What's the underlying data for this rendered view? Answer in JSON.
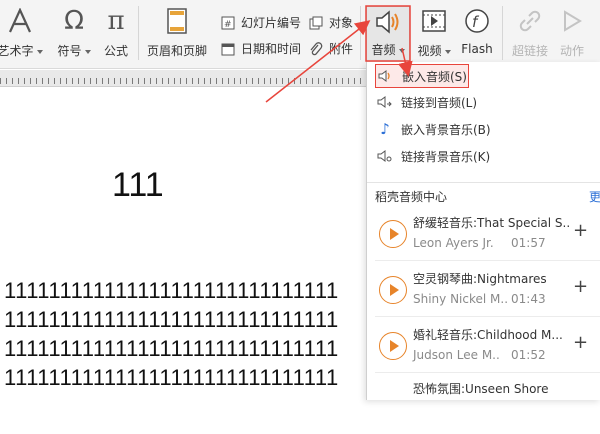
{
  "toolbar": {
    "wordart_label": "艺术字",
    "symbol_label": "符号",
    "formula_label": "公式",
    "header_footer_label": "页眉和页脚",
    "slide_number_label": "幻灯片编号",
    "object_label": "对象",
    "datetime_label": "日期和时间",
    "attachment_label": "附件",
    "audio_label": "音频",
    "video_label": "视频",
    "flash_label": "Flash",
    "hyperlink_label": "超链接",
    "action_label": "动作"
  },
  "slide": {
    "number_text": "111",
    "rows": [
      "111111111111111111111111111111",
      "111111111111111111111111111111",
      "111111111111111111111111111111",
      "111111111111111111111111111111"
    ]
  },
  "audio_menu": {
    "embed_audio": "嵌入音频(S)",
    "link_audio": "链接到音频(L)",
    "embed_bg_music": "嵌入背景音乐(B)",
    "link_bg_music": "链接背景音乐(K)"
  },
  "audio_center": {
    "title": "稻壳音频中心",
    "more": "更",
    "tracks": [
      {
        "title": "舒缓轻音乐:That Special S..",
        "artist": "Leon Ayers Jr.",
        "duration": "01:57"
      },
      {
        "title": "空灵钢琴曲:Nightmares",
        "artist": "Shiny Nickel M..",
        "duration": "01:43"
      },
      {
        "title": "婚礼轻音乐:Childhood M...",
        "artist": "Judson Lee M..",
        "duration": "01:52"
      },
      {
        "title": "恐怖氛围:Unseen Shore",
        "artist": "",
        "duration": ""
      }
    ],
    "add_symbol": "+"
  },
  "colors": {
    "accent_red": "#e8453c",
    "play_orange": "#e7842a",
    "link_blue": "#2b6fd6"
  }
}
